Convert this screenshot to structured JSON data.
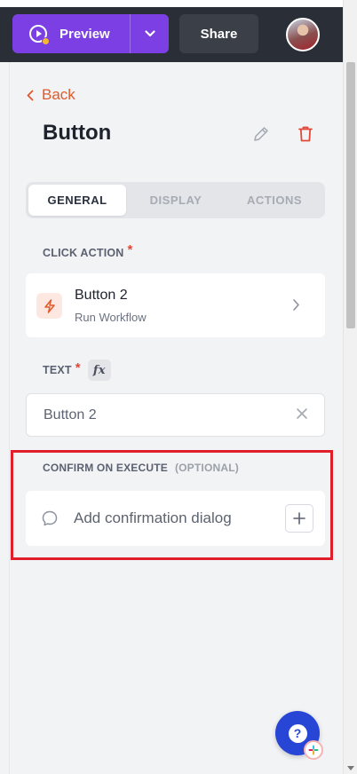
{
  "header": {
    "preview_label": "Preview",
    "share_label": "Share"
  },
  "panel": {
    "back_label": "Back",
    "title": "Button",
    "tabs": [
      {
        "label": "GENERAL",
        "active": true
      },
      {
        "label": "DISPLAY",
        "active": false
      },
      {
        "label": "ACTIONS",
        "active": false
      }
    ],
    "click_action": {
      "label": "CLICK ACTION",
      "required_mark": "*",
      "name": "Button 2",
      "type": "Run Workflow"
    },
    "text_field": {
      "label": "TEXT",
      "required_mark": "*",
      "fx_label": "fx",
      "value": "Button 2"
    },
    "confirm": {
      "label": "CONFIRM ON EXECUTE",
      "optional_label": "(OPTIONAL)",
      "placeholder": "Add confirmation dialog"
    }
  },
  "help": {
    "glyph": "?"
  },
  "colors": {
    "accent_purple": "#7b3fe4",
    "back_orange": "#e05a2b",
    "required_red": "#e2483a",
    "highlight_red": "#e01f2b",
    "help_blue": "#2746d6"
  },
  "icons": [
    "play-icon",
    "chevron-down-icon",
    "avatar",
    "chevron-left-icon",
    "pencil-icon",
    "trash-icon",
    "bolt-icon",
    "chevron-right-icon",
    "close-icon",
    "chat-bubble-icon",
    "plus-icon",
    "help-icon",
    "slack-icon"
  ]
}
